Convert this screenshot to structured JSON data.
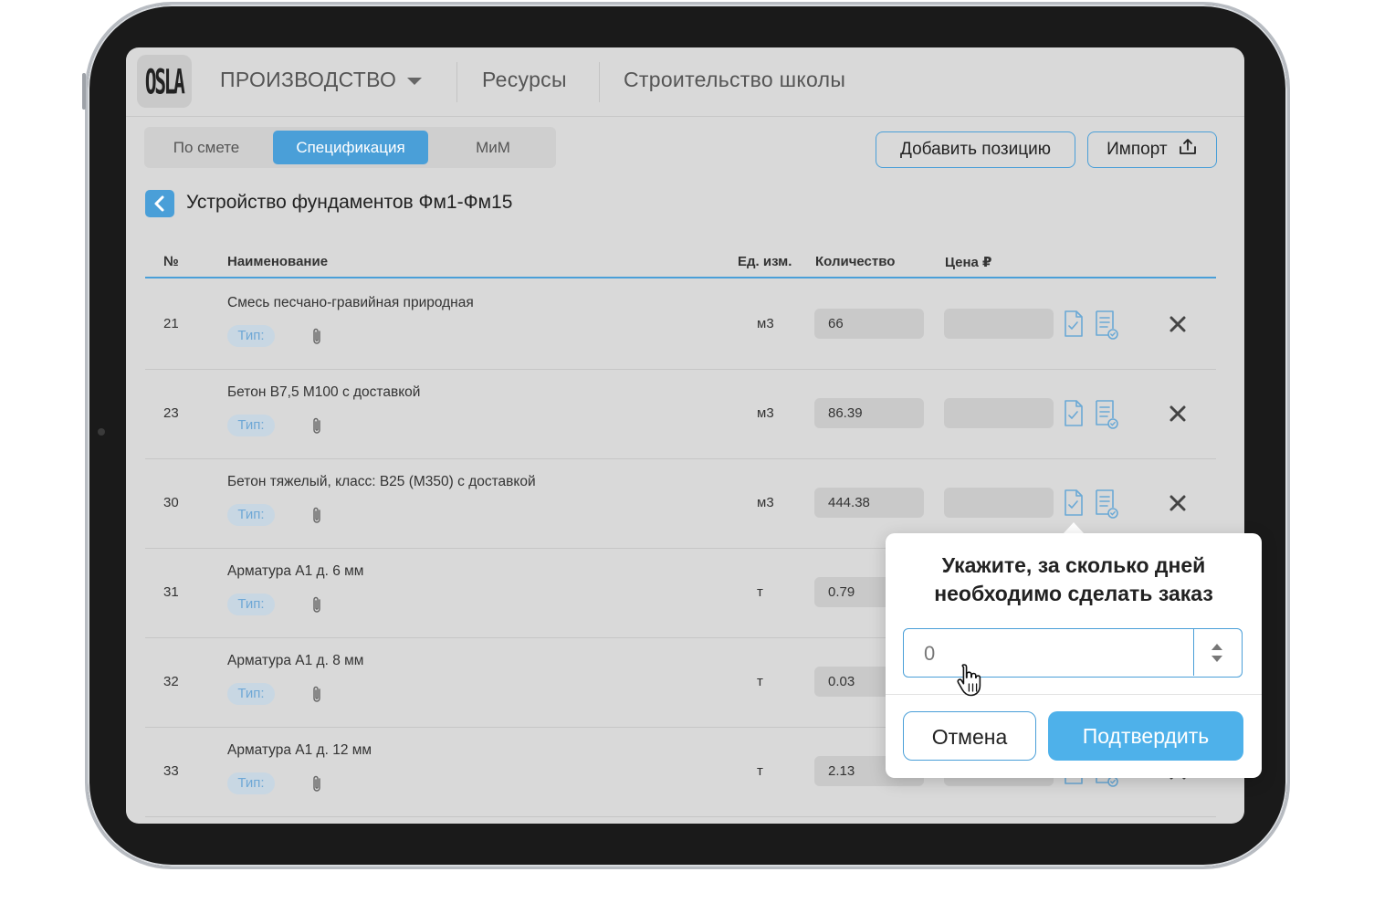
{
  "header": {
    "logo_text": "OSLA",
    "nav": [
      {
        "label": "ПРОИЗВОДСТВО"
      },
      {
        "label": "Ресурсы"
      },
      {
        "label": "Строительство школы"
      }
    ]
  },
  "tabs": [
    {
      "label": "По смете",
      "active": false
    },
    {
      "label": "Спецификация",
      "active": true
    },
    {
      "label": "МиМ",
      "active": false
    }
  ],
  "actions": {
    "add_label": "Добавить позицию",
    "import_label": "Импорт"
  },
  "page_title": "Устройство фундаментов Фм1-Фм15",
  "table": {
    "columns": {
      "num": "№",
      "name": "Наименование",
      "unit": "Ед. изм.",
      "qty": "Количество",
      "price": "Цена ₽"
    },
    "type_label": "Тип:",
    "rows": [
      {
        "num": "21",
        "name": "Смесь песчано-гравийная природная",
        "unit": "м3",
        "qty": "66"
      },
      {
        "num": "23",
        "name": "Бетон В7,5 М100 с доставкой",
        "unit": "м3",
        "qty": "86.39"
      },
      {
        "num": "30",
        "name": "Бетон тяжелый, класс: В25 (М350) с доставкой",
        "unit": "м3",
        "qty": "444.38"
      },
      {
        "num": "31",
        "name": "Арматура А1 д. 6 мм",
        "unit": "т",
        "qty": "0.79"
      },
      {
        "num": "32",
        "name": "Арматура А1 д. 8 мм",
        "unit": "т",
        "qty": "0.03"
      },
      {
        "num": "33",
        "name": "Арматура А1 д. 12 мм",
        "unit": "т",
        "qty": "2.13"
      }
    ]
  },
  "popup": {
    "title_line1": "Укажите, за сколько дней",
    "title_line2": "необходимо сделать заказ",
    "input_value": "0",
    "cancel_label": "Отмена",
    "confirm_label": "Подтвердить"
  },
  "colors": {
    "accent": "#4a9fd8",
    "confirm": "#4eb1ea",
    "screen_bg": "#d9d9d9"
  },
  "icons": [
    "chevron-down-icon",
    "upload-icon",
    "back-chevron-icon",
    "paperclip-icon",
    "document-check-icon",
    "list-check-icon",
    "close-icon",
    "spinner-arrows-icon",
    "hand-cursor-icon"
  ]
}
